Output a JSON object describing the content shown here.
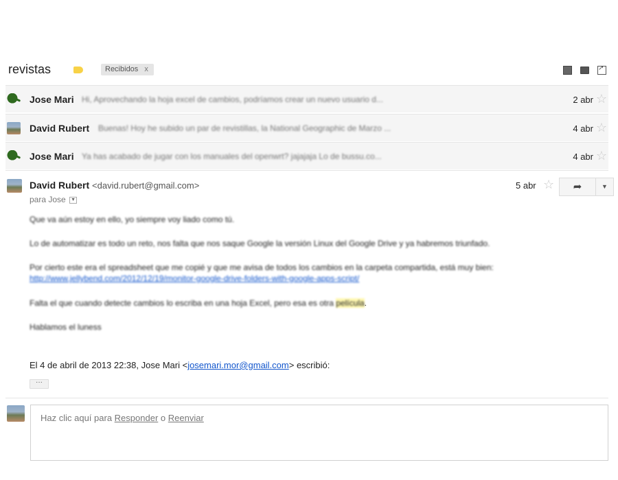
{
  "thread": {
    "subject": "revistas",
    "label_chip": "Recibidos",
    "chip_remove": "x"
  },
  "colors": {
    "label_tag": "#f8d247",
    "row_background": "#f5f5f5",
    "link": "#1155cc",
    "highlight": "#fff8b0"
  },
  "collapsed": [
    {
      "sender": "Jose Mari",
      "snippet": "Hi, Aprovechando la hoja excel de cambios, podríamos crear un nuevo usuario d...",
      "date": "2 abr",
      "avatar": "kiwi-bird-icon"
    },
    {
      "sender": "David Rubert",
      "snippet": "Buenas! Hoy he subido un par de revistillas, la National Geographic de Marzo ...",
      "date": "4 abr",
      "avatar": "photo-avatar"
    },
    {
      "sender": "Jose Mari",
      "snippet": "Ya has acabado de jugar con los manuales del openwrt? jajajaja Lo de bussu.co...",
      "date": "4 abr",
      "avatar": "kiwi-bird-icon"
    }
  ],
  "expanded": {
    "sender": "David Rubert",
    "email": "<david.rubert@gmail.com>",
    "to": "para Jose",
    "date": "5 abr",
    "body": {
      "line1": "Que va aún estoy en ello, yo siempre voy liado como tú.",
      "line2": "Lo de automatizar es todo un reto, nos falta que nos saque Google la versión Linux del Google Drive y ya habremos triunfado.",
      "line3": "Por  cierto este era el spreadsheet que me copié y que me avisa de todos los cambios en la carpeta compartida, está muy bien:",
      "link": "http://www.jellybend.com/2012/12/19/monitor-google-drive-folders-with-google-apps-script/",
      "line4a": "Falta el que cuando detecte cambios lo escriba en una hoja Excel, pero esa es otra",
      "line4b": "película",
      "line4c": ".",
      "line5": "Hablamos el luness"
    },
    "quote": {
      "prefix": "El 4 de abril de 2013 22:38, Jose Mari <",
      "email": "josemari.mor@gmail.com",
      "suffix": "> escribió:",
      "toggle": "···"
    }
  },
  "reply": {
    "prefix": "Haz clic aquí para ",
    "reply_link": "Responder",
    "middle": " o ",
    "forward_link": "Reenviar"
  }
}
